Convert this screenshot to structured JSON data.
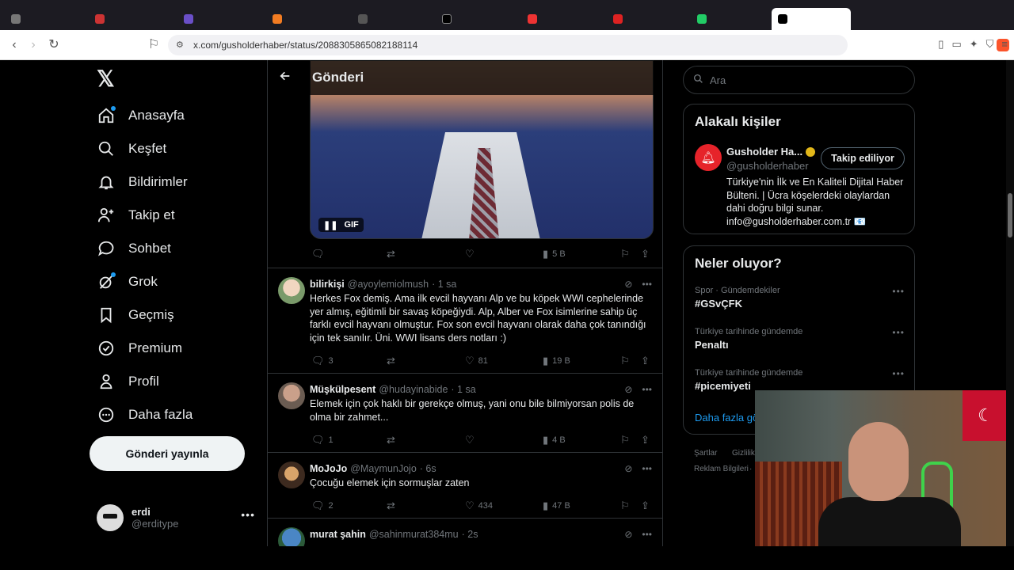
{
  "browser": {
    "tabs": [
      "",
      "",
      "",
      "",
      "",
      "",
      "",
      "",
      "",
      ""
    ],
    "url": "x.com/gusholderhaber/status/2088305865082188114"
  },
  "nav": {
    "items": [
      {
        "label": "Anasayfa",
        "icon": "home-icon"
      },
      {
        "label": "Keşfet",
        "icon": "search-icon"
      },
      {
        "label": "Bildirimler",
        "icon": "bell-icon"
      },
      {
        "label": "Takip et",
        "icon": "add-person-icon"
      },
      {
        "label": "Sohbet",
        "icon": "chat-icon"
      },
      {
        "label": "Grok",
        "icon": "grok-icon"
      },
      {
        "label": "Geçmiş",
        "icon": "bookmark-icon"
      },
      {
        "label": "Premium",
        "icon": "verified-icon"
      },
      {
        "label": "Profil",
        "icon": "person-icon"
      },
      {
        "label": "Daha fazla",
        "icon": "more-circle-icon"
      }
    ],
    "post_button": "Gönderi yayınla",
    "account": {
      "name": "erdi",
      "handle": "@erditype"
    }
  },
  "header": {
    "title": "Gönderi"
  },
  "media": {
    "badge": "GIF"
  },
  "main_post_actions": {
    "views": "5 B"
  },
  "replies": [
    {
      "name": "bilirkişi",
      "handle": "@ayoylemiolmush",
      "time": "· 1 sa",
      "text": "Herkes Fox demiş. Ama ilk evcil hayvanı Alp ve bu köpek WWI cephelerinde yer almış, eğitimli bir savaş köpeğiydi. Alp, Alber ve Fox isimlerine sahip üç farklı evcil hayvanı olmuştur. Fox son evcil hayvanı olarak daha çok tanındığı için tek sanılır. Üni. WWI lisans ders notları :)",
      "replies": "3",
      "likes": "81",
      "views": "19 B"
    },
    {
      "name": "Müşkülpesent",
      "handle": "@hudayinabide",
      "time": "· 1 sa",
      "text": "Elemek için çok haklı bir gerekçe olmuş, yani onu bile bilmiyorsan polis de olma bir zahmet...",
      "replies": "1",
      "likes": "",
      "views": "4 B"
    },
    {
      "name": "MoJoJo",
      "handle": "@MaymunJojo",
      "time": "· 6s",
      "text": "Çocuğu elemek için sormuşlar zaten",
      "replies": "2",
      "likes": "434",
      "views": "47 B"
    },
    {
      "name": "murat şahin",
      "handle": "@sahinmurat384mu",
      "time": "· 2s",
      "text": "",
      "replies": "",
      "likes": "",
      "views": ""
    }
  ],
  "right": {
    "search_placeholder": "Ara",
    "related_title": "Alakalı kişiler",
    "related": {
      "name": "Gusholder Ha...",
      "handle": "@gusholderhaber",
      "follow_label": "Takip ediliyor",
      "bio": "Türkiye'nin İlk ve En Kaliteli Dijital Haber Bülteni. | Ücra köşelerdeki olaylardan dahi doğru bilgi sunar. info@gusholderhaber.com.tr 📧"
    },
    "trends_title": "Neler oluyor?",
    "trends": [
      {
        "meta": "Spor · Gündemdekiler",
        "name": "#GSvÇFK"
      },
      {
        "meta": "Türkiye tarihinde gündemde",
        "name": "Penaltı"
      },
      {
        "meta": "Türkiye tarihinde gündemde",
        "name": "#picemiyeti"
      }
    ],
    "show_more": "Daha fazla gö",
    "footer": [
      "Şartlar",
      "Gizlilik",
      "Reklam Bilgileri",
      "·"
    ]
  },
  "colors": {
    "accent": "#1d9bf0",
    "brand": "#000000",
    "verified": "#e2b719"
  }
}
